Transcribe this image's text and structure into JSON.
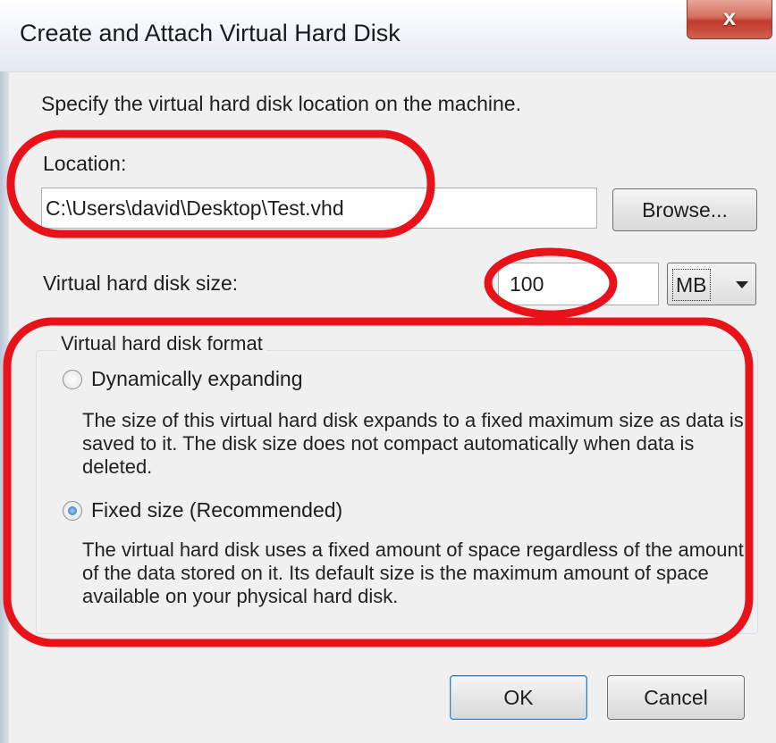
{
  "window": {
    "title": "Create and Attach Virtual Hard Disk",
    "close_glyph": "x"
  },
  "instruction": "Specify the virtual hard disk location on the machine.",
  "location": {
    "label": "Location:",
    "value": "C:\\Users\\david\\Desktop\\Test.vhd",
    "browse_label": "Browse..."
  },
  "size": {
    "label": "Virtual hard disk size:",
    "value": "100",
    "unit": "MB"
  },
  "format": {
    "legend": "Virtual hard disk format",
    "options": [
      {
        "label": "Dynamically expanding",
        "selected": false,
        "description": "The size of this virtual hard disk expands to a fixed maximum size as data is saved to it.  The disk size does not compact automatically when data is deleted."
      },
      {
        "label": "Fixed size (Recommended)",
        "selected": true,
        "description": "The virtual hard disk uses a fixed amount of space regardless of the amount of the data stored on it.  Its default size is the maximum amount of space available on your physical hard disk."
      }
    ]
  },
  "buttons": {
    "ok": "OK",
    "cancel": "Cancel"
  },
  "colors": {
    "annotation": "#e8121b",
    "window_bg": "#f0f0f0",
    "close_button": "#c0392b"
  }
}
